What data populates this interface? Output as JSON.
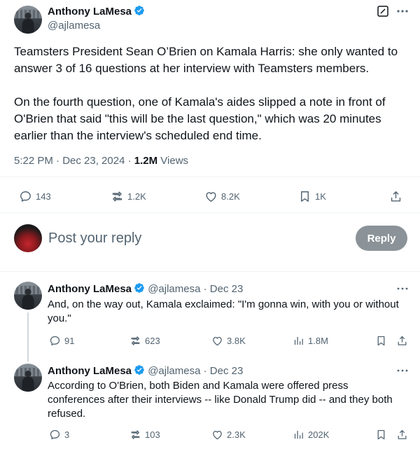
{
  "main_tweet": {
    "author_name": "Anthony LaMesa",
    "author_handle": "@ajlamesa",
    "paragraph1": "Teamsters President Sean O’Brien on Kamala Harris: she only wanted to answer 3 of 16 questions at her interview with Teamsters members.",
    "paragraph2": "On the fourth question, one of Kamala's aides slipped a note in front of O'Brien that said \"this will be the last question,\" which was 20 minutes earlier than the interview's scheduled end time.",
    "time": "5:22 PM · Dec 23, 2024 · ",
    "views_count": "1.2M",
    "views_label": " Views",
    "replies": "143",
    "reposts": "1.2K",
    "likes": "8.2K",
    "bookmarks": "1K"
  },
  "composer": {
    "placeholder": "Post your reply",
    "reply_button": "Reply"
  },
  "replies": [
    {
      "author_name": "Anthony LaMesa",
      "author_handle": "@ajlamesa",
      "date": "· Dec 23",
      "text": "And, on the way out, Kamala exclaimed: \"I'm gonna win, with you or without you.\"",
      "replies": "91",
      "reposts": "623",
      "likes": "3.8K",
      "views": "1.8M"
    },
    {
      "author_name": "Anthony LaMesa",
      "author_handle": "@ajlamesa",
      "date": "· Dec 23",
      "text": "According to O'Brien, both Biden and Kamala were offered press conferences after their interviews -- like Donald Trump did -- and they both refused.",
      "replies": "3",
      "reposts": "103",
      "likes": "2.3K",
      "views": "202K"
    }
  ],
  "colors": {
    "verified": "#1d9bf0",
    "reply_button_bg": "#8b9398",
    "muted": "#536471"
  }
}
